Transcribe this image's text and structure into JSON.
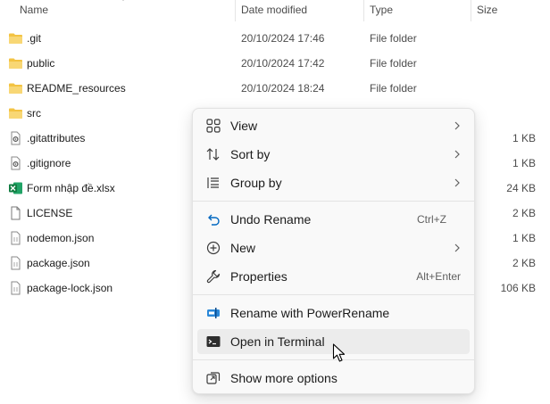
{
  "columns": {
    "name": "Name",
    "date_modified": "Date modified",
    "type": "Type",
    "size": "Size"
  },
  "files": [
    {
      "name": ".git",
      "date": "20/10/2024 17:46",
      "type": "File folder",
      "size": "",
      "icon": "folder-icon"
    },
    {
      "name": "public",
      "date": "20/10/2024 17:42",
      "type": "File folder",
      "size": "",
      "icon": "folder-icon"
    },
    {
      "name": "README_resources",
      "date": "20/10/2024 18:24",
      "type": "File folder",
      "size": "",
      "icon": "folder-icon"
    },
    {
      "name": "src",
      "date": "",
      "type": "",
      "size": "",
      "icon": "folder-icon"
    },
    {
      "name": ".gitattributes",
      "date": "",
      "type": "",
      "size": "1 KB",
      "icon": "settings-file-icon"
    },
    {
      "name": ".gitignore",
      "date": "",
      "type": "",
      "size": "1 KB",
      "icon": "settings-file-icon"
    },
    {
      "name": "Form nhập đề.xlsx",
      "date": "",
      "type": "",
      "size": "24 KB",
      "icon": "excel-file-icon"
    },
    {
      "name": "LICENSE",
      "date": "",
      "type": "",
      "size": "2 KB",
      "icon": "file-icon"
    },
    {
      "name": "nodemon.json",
      "date": "",
      "type": "",
      "size": "1 KB",
      "icon": "json-file-icon"
    },
    {
      "name": "package.json",
      "date": "",
      "type": "",
      "size": "2 KB",
      "icon": "json-file-icon"
    },
    {
      "name": "package-lock.json",
      "date": "",
      "type": "",
      "size": "106 KB",
      "icon": "json-file-icon"
    }
  ],
  "context_menu": {
    "view": {
      "label": "View",
      "icon": "grid-view-icon"
    },
    "sort_by": {
      "label": "Sort by",
      "icon": "sort-icon"
    },
    "group_by": {
      "label": "Group by",
      "icon": "group-by-icon"
    },
    "undo_rename": {
      "label": "Undo Rename",
      "shortcut": "Ctrl+Z",
      "icon": "undo-icon"
    },
    "new": {
      "label": "New",
      "icon": "plus-circle-icon"
    },
    "properties": {
      "label": "Properties",
      "shortcut": "Alt+Enter",
      "icon": "wrench-icon"
    },
    "rename_power": {
      "label": "Rename with PowerRename",
      "icon": "powerrename-icon"
    },
    "open_terminal": {
      "label": "Open in Terminal",
      "icon": "terminal-icon"
    },
    "show_more": {
      "label": "Show more options",
      "icon": "show-more-icon"
    }
  },
  "colors": {
    "folder": "#f3c342",
    "excel": "#1d6f42",
    "accent": "#0067c0",
    "hover": "#ececec"
  }
}
